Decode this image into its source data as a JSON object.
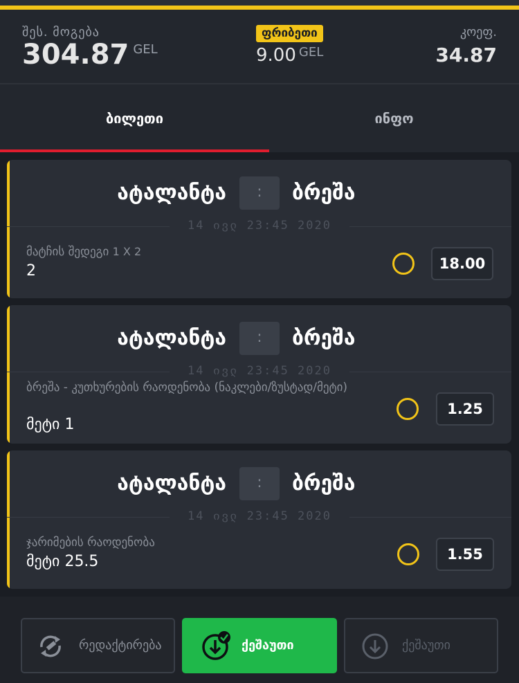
{
  "summary": {
    "potential_win_label": "შეს. მოგება",
    "potential_win_value": "304.87",
    "currency": "GEL",
    "freebet_label": "ფრიბეთი",
    "freebet_value": "9.00",
    "coef_label": "კოეფ.",
    "coef_value": "34.87"
  },
  "tabs": [
    {
      "label": "ბილეთი",
      "active": true
    },
    {
      "label": "ინფო",
      "active": false
    }
  ],
  "bets": [
    {
      "home": "ატალანტა",
      "away": "ბრეშა",
      "score_sep": ":",
      "date": "14 ივლ 23:45 2020",
      "market": "მატჩის შედეგი",
      "market_extra": "1 X 2",
      "pick": "2",
      "odd": "18.00"
    },
    {
      "home": "ატალანტა",
      "away": "ბრეშა",
      "score_sep": ":",
      "date": "14 ივლ 23:45 2020",
      "market": "ბრეშა - კუთხურების რაოდენობა (ნაკლები/ზუსტად/მეტი)",
      "market_extra": "",
      "pick": "მეტი 1",
      "odd": "1.25"
    },
    {
      "home": "ატალანტა",
      "away": "ბრეშა",
      "score_sep": ":",
      "date": "14 ივლ 23:45 2020",
      "market": "ჯარიმების რაოდენობა",
      "market_extra": "",
      "pick": "მეტი 25.5",
      "odd": "1.55"
    }
  ],
  "actions": {
    "edit_label": "რედაქტირება",
    "bet_label": "ქეშაუთი",
    "save_label": "ქეშაუთი"
  },
  "colors": {
    "accent": "#f2c418",
    "tab_indicator": "#e11d2e",
    "primary_button": "#1fb84a"
  }
}
